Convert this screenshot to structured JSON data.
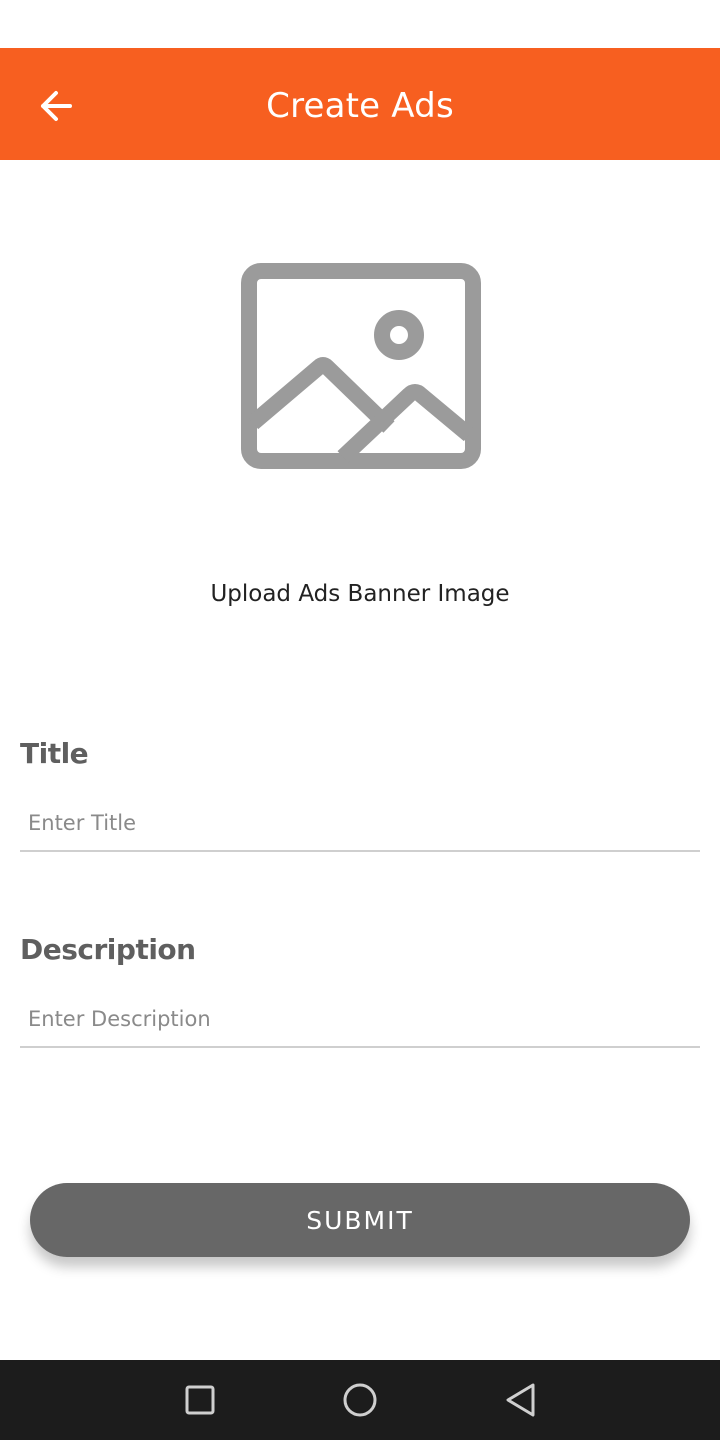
{
  "app_bar": {
    "title": "Create Ads",
    "back_icon": "arrow-left-icon",
    "background": "#f75f20"
  },
  "upload": {
    "icon": "image-placeholder-icon",
    "label": "Upload Ads Banner Image"
  },
  "form": {
    "title": {
      "label": "Title",
      "value": "",
      "placeholder": "Enter Title"
    },
    "description": {
      "label": "Description",
      "value": "",
      "placeholder": "Enter Description"
    }
  },
  "submit": {
    "label": "SUBMIT",
    "background": "#676767"
  },
  "nav_bar": {
    "recents_icon": "square-icon",
    "home_icon": "circle-icon",
    "back_icon": "triangle-back-icon"
  }
}
